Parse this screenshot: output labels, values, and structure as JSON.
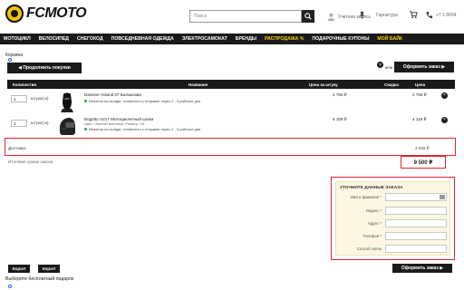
{
  "header": {
    "logo_text": "FCMOTO",
    "search_placeholder": "Поиск",
    "account_label": "Учетная запись",
    "currency_label": "Гарнитура",
    "phone_label": "+7 1 8004"
  },
  "menu": {
    "items": [
      {
        "label": "МОТОЦИКЛ",
        "highlight": false
      },
      {
        "label": "ВЕЛОСИПЕД",
        "highlight": false
      },
      {
        "label": "СНЕГОХОД",
        "highlight": false
      },
      {
        "label": "ПОВСЕДНЕВНАЯ ОДЕЖДА",
        "highlight": false
      },
      {
        "label": "ЭЛЕКТРОСАМОКАТ",
        "highlight": false
      },
      {
        "label": "БРЕНДЫ",
        "highlight": false
      },
      {
        "label": "РАСПРОДАЖА %",
        "highlight": true
      },
      {
        "label": "ПОДАРОЧНЫЕ КУПОНЫ",
        "highlight": false
      },
      {
        "label": "МОЙ БАЙК",
        "highlight": true
      }
    ]
  },
  "cart": {
    "title": "Корзина",
    "continue_button": "◀ Продолжить покупки",
    "help_label": "ючи",
    "order_button": "Оформить заказ ▶",
    "columns": {
      "quantity": "Количество",
      "name": "Название",
      "list_price": "Цена за штуку",
      "discount": "Скидка",
      "price": "Цена"
    },
    "items": [
      {
        "qty": "1",
        "unit": "штука(-и)",
        "name": "Daniexe Voland 07 Балаклава",
        "stock": "Имеется на складе, готовность к отправке через 2 - 3 рабочих дня",
        "unit_price": "2 756 ₽",
        "line_price": "2 756 ₽"
      },
      {
        "qty": "1",
        "unit": "штука(-и)",
        "name": "Bogotto V217 Мотоциклетный шлем",
        "subtitle": "Цвет: Черный матовый, Размер: XS",
        "stock": "Имеется на складе, готовность к отправке через 2 - 3 рабочих дня",
        "unit_price": "4 108 ₽",
        "line_price": "4 118 ₽"
      }
    ],
    "delivery_label": "Доставка",
    "delivery_price": "2 626 ₽",
    "total_label": "Итоговая сумма заказа",
    "total_value": "9 500 ₽"
  },
  "order_form": {
    "title": "УТОЧНИТЕ ДАННЫЕ ЗАКАЗА",
    "fields": [
      {
        "label": "Имя и фамилия *"
      },
      {
        "label": "Индекс *"
      },
      {
        "label": "Адрес *"
      },
      {
        "label": "Телефон *"
      },
      {
        "label": "Способ связи"
      }
    ]
  },
  "footer": {
    "export_label": "Export",
    "import_label": "Import",
    "order_button": "Оформить заказ ▶",
    "gift_label": "Выберите бесплатный подарок"
  },
  "colors": {
    "accent_yellow": "#f5d000",
    "highlight_red": "#e0242c",
    "dark": "#1a1a1a"
  }
}
